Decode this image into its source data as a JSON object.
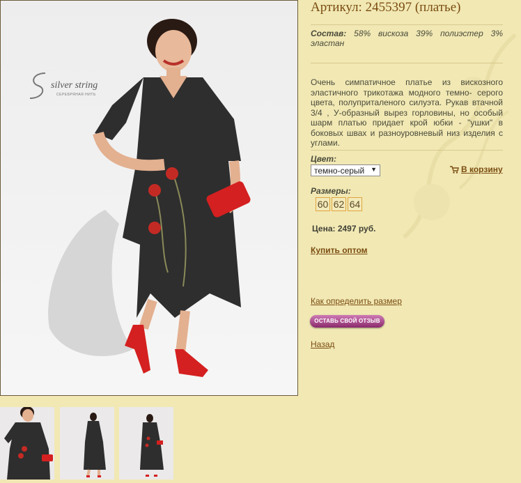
{
  "product": {
    "title": "Артикул: 2455397 (платье)",
    "composition_label": "Состав:",
    "composition_value": " 58% вискоза 39% полиэстер 3% эластан",
    "description": "Очень симпатичное платье из вискозного эластичного трикотажа модного темно- серого цвета, полуприталеного силуэта. Рукав втачной 3/4 , У-образный вырез горловины, но особый шарм платью придает крой юбки - \"ушки\" в боковых швах и разноуровневый низ изделия с углами.",
    "color_label": "Цвет:",
    "color_selected": "темно-серый",
    "add_to_cart": "В корзину",
    "sizes_label": "Размеры:",
    "sizes": [
      "60",
      "62",
      "64"
    ],
    "price": "Цена: 2497 руб.",
    "buy_wholesale": "Купить оптом",
    "size_guide": "Как определить размер",
    "leave_review": "ОСТАВЬ СВОЙ ОТЗЫВ",
    "back": "Назад"
  },
  "brand": {
    "name": "silver string",
    "subtitle": "СЕРЕБРЯНАЯ НИТЬ"
  },
  "colors": {
    "background": "#f1e8b4",
    "link": "#7a4c10",
    "dress": "#2e2e2e",
    "accent_red": "#d42020"
  },
  "icons": {
    "cart": "cart-icon"
  }
}
